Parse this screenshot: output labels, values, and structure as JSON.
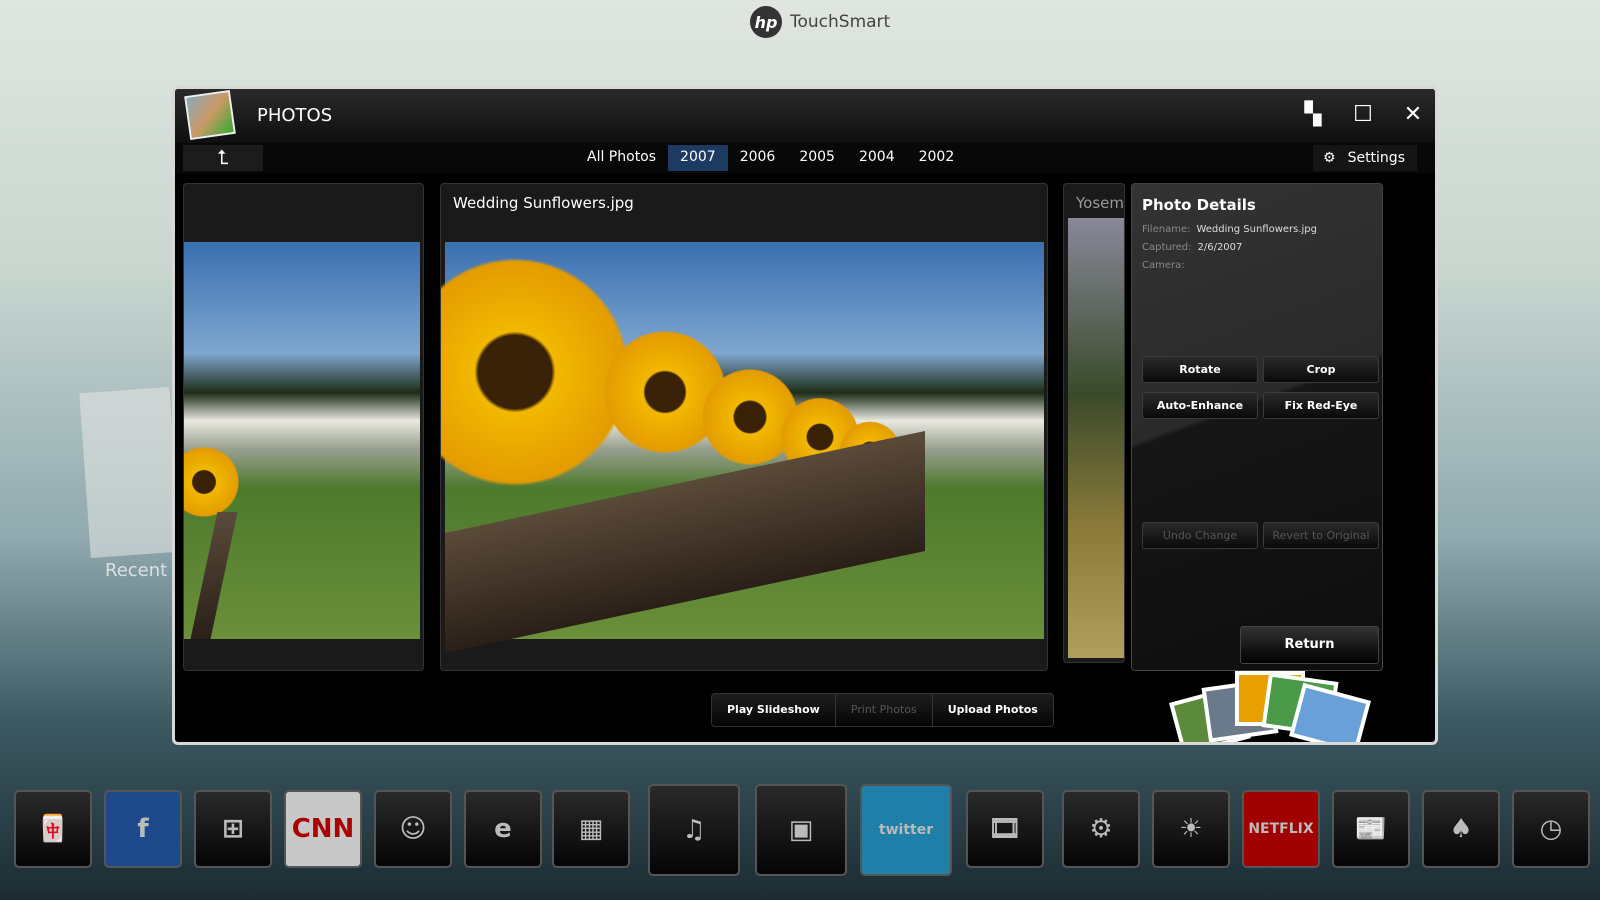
{
  "brand": {
    "logo": "hp",
    "name": "TouchSmart"
  },
  "background": {
    "recent_label": "Recent"
  },
  "window": {
    "title": "PHOTOS",
    "controls": [
      "restore-icon",
      "maximize-icon",
      "close-icon"
    ]
  },
  "nav": {
    "back_icon": "back-arrow-icon",
    "years": [
      "All Photos",
      "2007",
      "2006",
      "2005",
      "2004",
      "2002"
    ],
    "selected": "2007",
    "settings_label": "Settings"
  },
  "center": {
    "title": "Wedding Sunflowers.jpg"
  },
  "next": {
    "title": "Yosem"
  },
  "details": {
    "title": "Photo Details",
    "filename_label": "Filename:",
    "filename": "Wedding Sunflowers.jpg",
    "captured_label": "Captured:",
    "captured": "2/6/2007",
    "camera_label": "Camera:",
    "rotate": "Rotate",
    "crop": "Crop",
    "auto_enhance": "Auto-Enhance",
    "fix_red_eye": "Fix Red-Eye",
    "undo": "Undo Change",
    "revert": "Revert to Original",
    "return": "Return"
  },
  "bottom": {
    "play": "Play Slideshow",
    "print": "Print Photos",
    "upload": "Upload Photos"
  },
  "dock": [
    {
      "name": "mahjong",
      "glyph": "🀄"
    },
    {
      "name": "facebook",
      "glyph": "f"
    },
    {
      "name": "windows",
      "glyph": "⊞"
    },
    {
      "name": "cnn",
      "glyph": "CNN"
    },
    {
      "name": "canvas",
      "glyph": "☺"
    },
    {
      "name": "internet-explorer",
      "glyph": "e"
    },
    {
      "name": "calendar",
      "glyph": "▦"
    },
    {
      "name": "music",
      "glyph": "♫"
    },
    {
      "name": "photos",
      "glyph": "▣"
    },
    {
      "name": "twitter",
      "glyph": "twitter"
    },
    {
      "name": "video",
      "glyph": "🎞"
    },
    {
      "name": "settings",
      "glyph": "⚙"
    },
    {
      "name": "weather",
      "glyph": "☀"
    },
    {
      "name": "netflix",
      "glyph": "NETFLIX"
    },
    {
      "name": "rss",
      "glyph": "📰"
    },
    {
      "name": "solitaire",
      "glyph": "♠"
    },
    {
      "name": "clock",
      "glyph": "◷"
    }
  ],
  "colors": {
    "selected_year": "#1d3a63",
    "facebook": "#1e4a8c",
    "cnn": "#c8c8c8",
    "twitter": "#1f7fa8",
    "netflix": "#a00000"
  }
}
